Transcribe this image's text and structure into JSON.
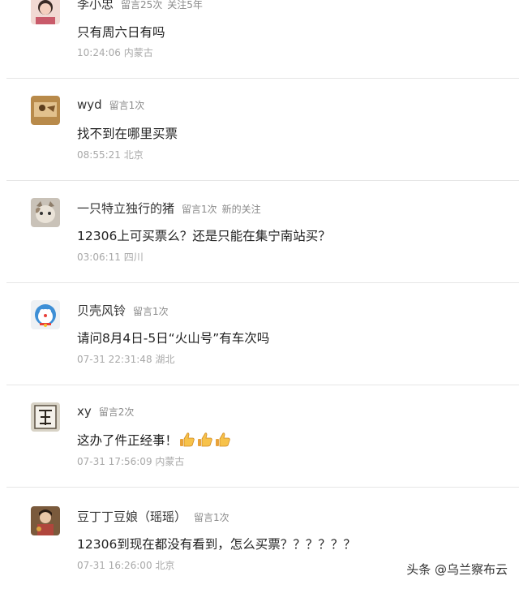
{
  "comments": [
    {
      "name": "李小忠",
      "meta": "留言25次",
      "meta2": "关注5年",
      "text": "只有周六日有吗",
      "time": "10:24:06 内蒙古"
    },
    {
      "name": "wyd",
      "meta": "留言1次",
      "text": "找不到在哪里买票",
      "time": "08:55:21 北京"
    },
    {
      "name": "一只特立独行的猪",
      "meta": "留言1次",
      "meta2": "新的关注",
      "text": "12306上可买票么？还是只能在集宁南站买？",
      "time": "03:06:11 四川"
    },
    {
      "name": "贝壳风铃",
      "meta": "留言1次",
      "text": "请问8月4日-5日“火山号”有车次吗",
      "time": "07-31 22:31:48 湖北"
    },
    {
      "name": "xy",
      "meta": "留言2次",
      "text": "这办了件正经事！",
      "emoji": "thumbs-up-icon ×3",
      "time": "07-31 17:56:09 内蒙古"
    },
    {
      "name": "豆丁丁豆娘（瑶瑶）",
      "meta": "留言1次",
      "text": "12306到现在都没有看到，怎么买票？？？？？？",
      "time": "07-31 16:26:00 北京"
    }
  ],
  "watermark": "头条 @乌兰察布云"
}
